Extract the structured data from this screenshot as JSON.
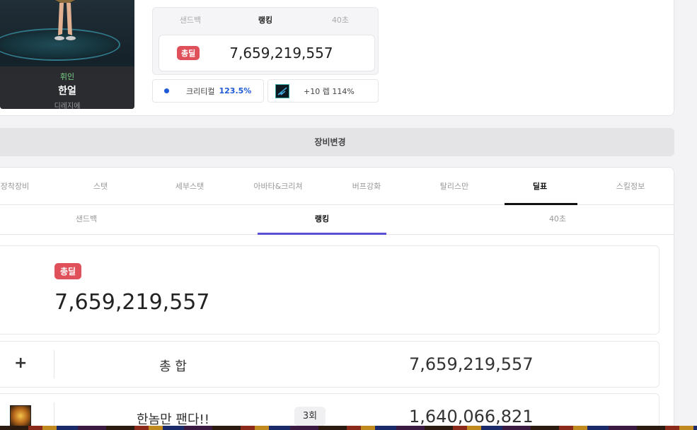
{
  "character": {
    "job": "휘인",
    "name": "한얼",
    "server": "디레지에"
  },
  "mini_panel": {
    "tabs": [
      "샌드백",
      "랭킹",
      "40초"
    ],
    "active_tab": "랭킹",
    "total_badge": "총딜",
    "total_value": "7,659,219,557"
  },
  "buffs": {
    "crit_label": "크리티컬",
    "crit_value": "123.5%",
    "item_label": "+10 렙 114%"
  },
  "equip_button": "장비변경",
  "tabs": [
    "장착장비",
    "스탯",
    "세부스탯",
    "아바타&크리쳐",
    "버프강화",
    "탈리스만",
    "딜표",
    "스킬정보"
  ],
  "active_tab": "딜표",
  "subtabs": [
    "샌드백",
    "랭킹",
    "40초"
  ],
  "active_subtab": "랭킹",
  "total": {
    "badge": "총딜",
    "value": "7,659,219,557"
  },
  "rows": [
    {
      "icon": "plus-icon",
      "name": "총 합",
      "value": "7,659,219,557",
      "count": ""
    },
    {
      "icon": "skill-icon",
      "name": "한놈만 팬다!!",
      "value": "1,640,066,821",
      "count": "3회"
    }
  ],
  "colors": {
    "badge_red": "#e0505a",
    "subtab_accent": "#5b4fd6",
    "crit_blue": "#1e5ad6"
  }
}
